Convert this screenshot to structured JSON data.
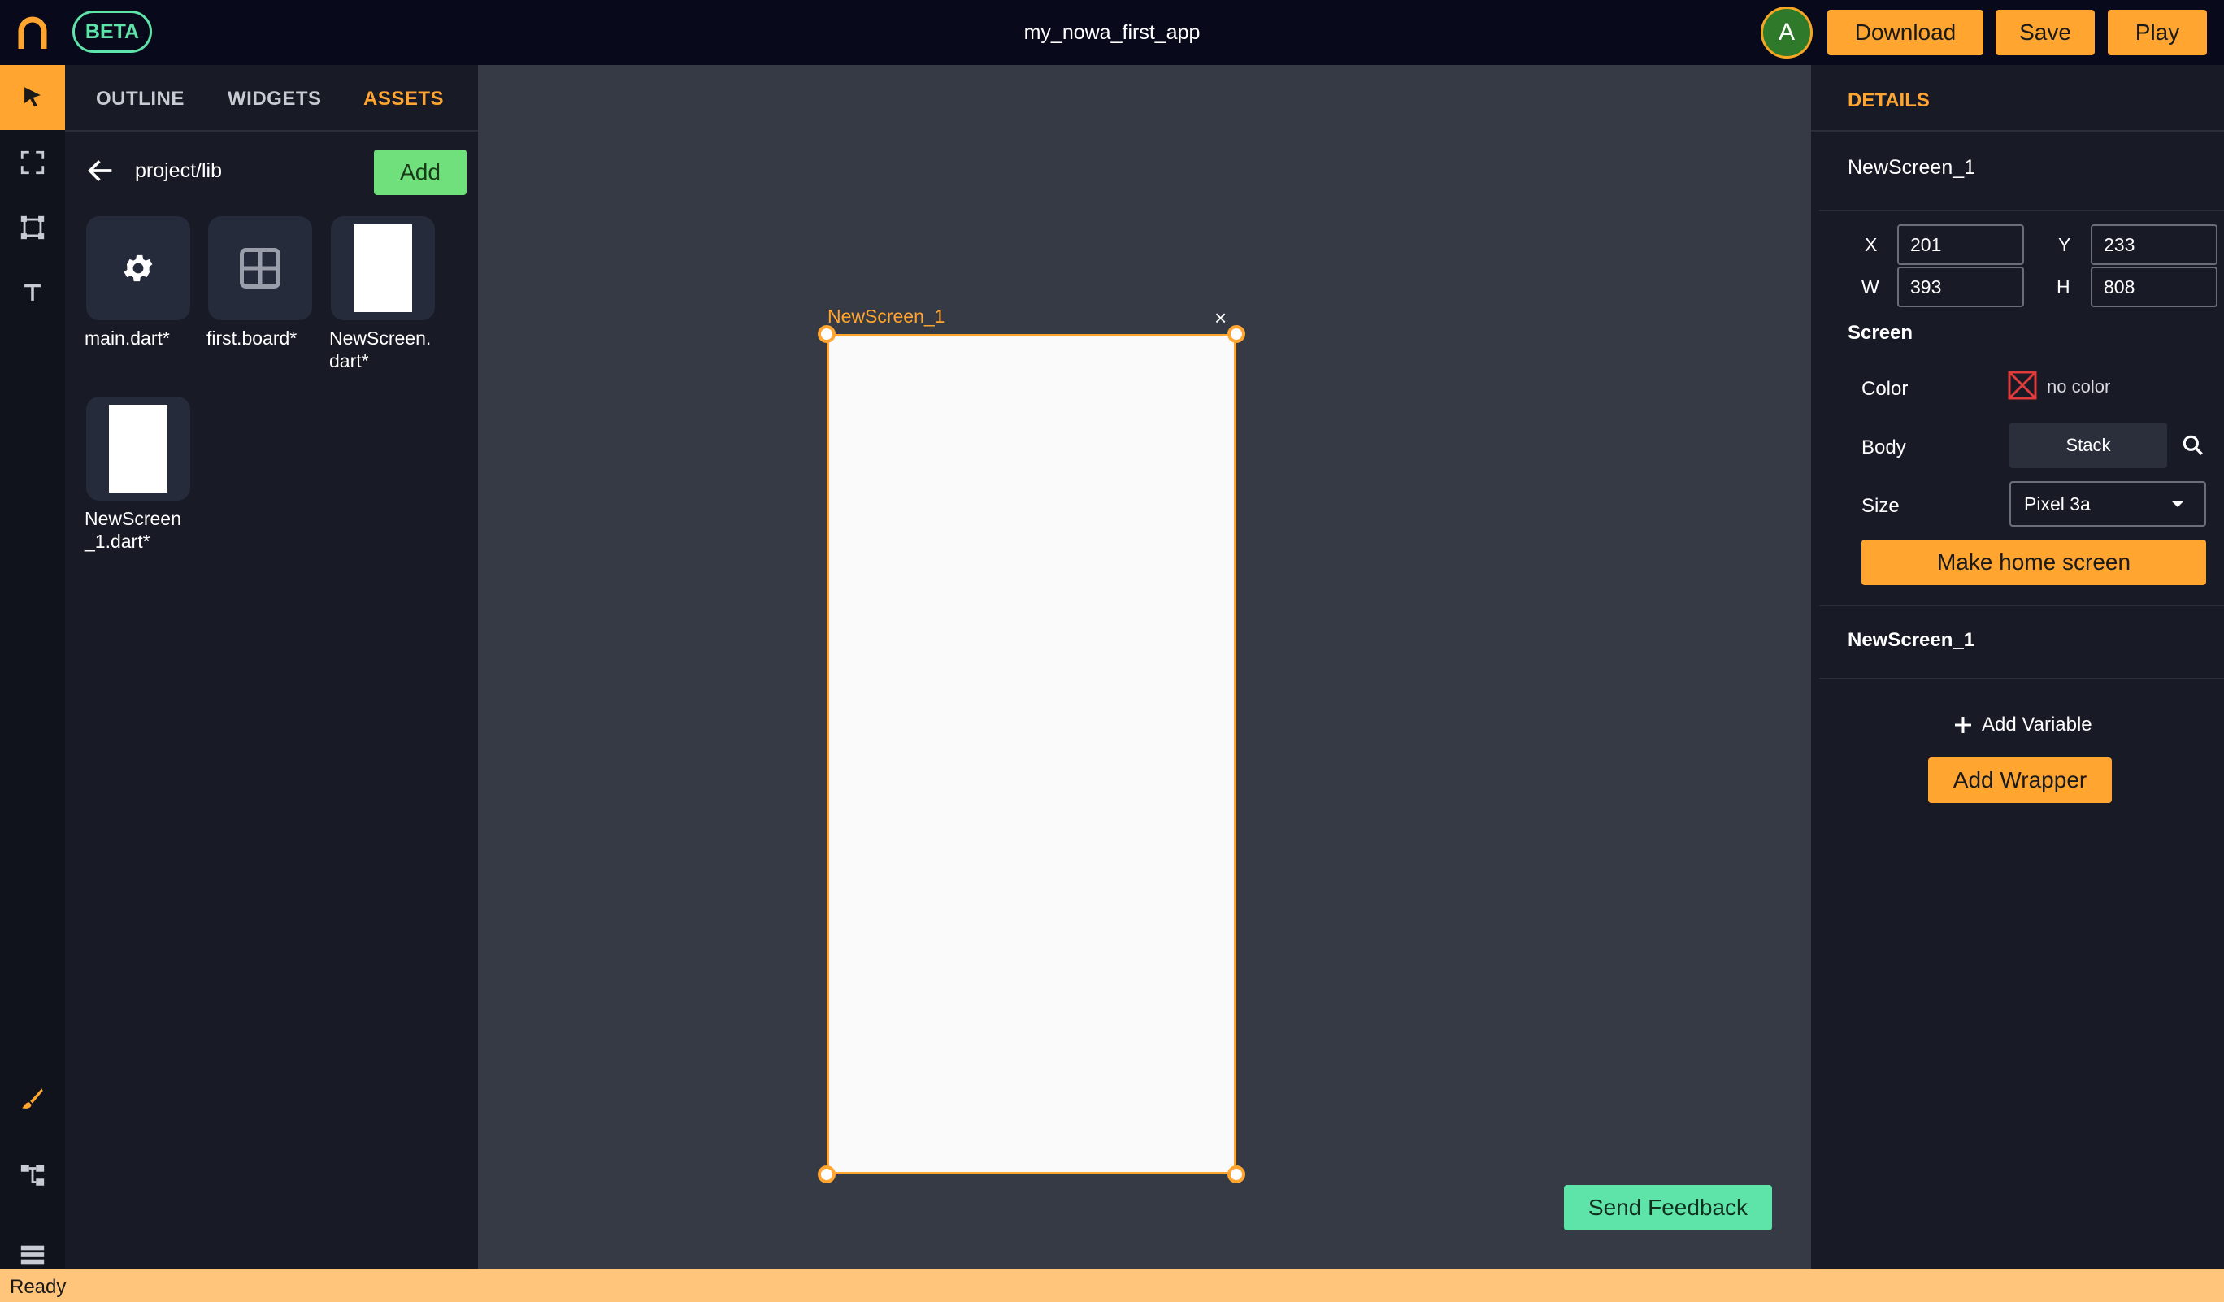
{
  "header": {
    "beta_label": "BETA",
    "project_title": "my_nowa_first_app",
    "avatar_initial": "A",
    "download_label": "Download",
    "save_label": "Save",
    "play_label": "Play"
  },
  "toolbar": {
    "tools": [
      {
        "icon": "pointer-icon",
        "active": true
      },
      {
        "icon": "fullscreen-icon",
        "active": false
      },
      {
        "icon": "frame-icon",
        "active": false
      },
      {
        "icon": "text-icon",
        "active": false
      }
    ],
    "bottom_tools": [
      "brush-icon",
      "tree-icon",
      "list-icon"
    ]
  },
  "left_panel": {
    "tabs": [
      {
        "label": "OUTLINE",
        "active": false
      },
      {
        "label": "WIDGETS",
        "active": false
      },
      {
        "label": "ASSETS",
        "active": true
      }
    ],
    "path": "project/lib",
    "add_label": "Add",
    "assets": [
      {
        "label": "main.dart*",
        "icon": "gear-icon"
      },
      {
        "label": "first.board*",
        "icon": "grid-icon"
      },
      {
        "label": "NewScreen.\ndart*",
        "icon": "page-icon"
      },
      {
        "label": "NewScreen\n_1.dart*",
        "icon": "page-icon"
      }
    ]
  },
  "canvas": {
    "screen_name": "NewScreen_1",
    "close_symbol": "×",
    "feedback_label": "Send Feedback"
  },
  "details": {
    "title": "DETAILS",
    "selected_name": "NewScreen_1",
    "x_label": "X",
    "x_value": "201",
    "y_label": "Y",
    "y_value": "233",
    "w_label": "W",
    "w_value": "393",
    "h_label": "H",
    "h_value": "808",
    "section_label": "Screen",
    "color_label": "Color",
    "color_value": "no color",
    "body_label": "Body",
    "body_value": "Stack",
    "size_label": "Size",
    "size_value": "Pixel 3a",
    "home_button_label": "Make home screen",
    "class_name": "NewScreen_1",
    "add_variable_label": "Add Variable",
    "add_wrapper_label": "Add Wrapper"
  },
  "status": {
    "text": "Ready"
  },
  "colors": {
    "accent": "#ffa530",
    "green": "#6fe07c",
    "mint": "#5ee3a8",
    "topbar": "#080a1c",
    "panel": "#181a26",
    "canvas": "#363a44"
  }
}
